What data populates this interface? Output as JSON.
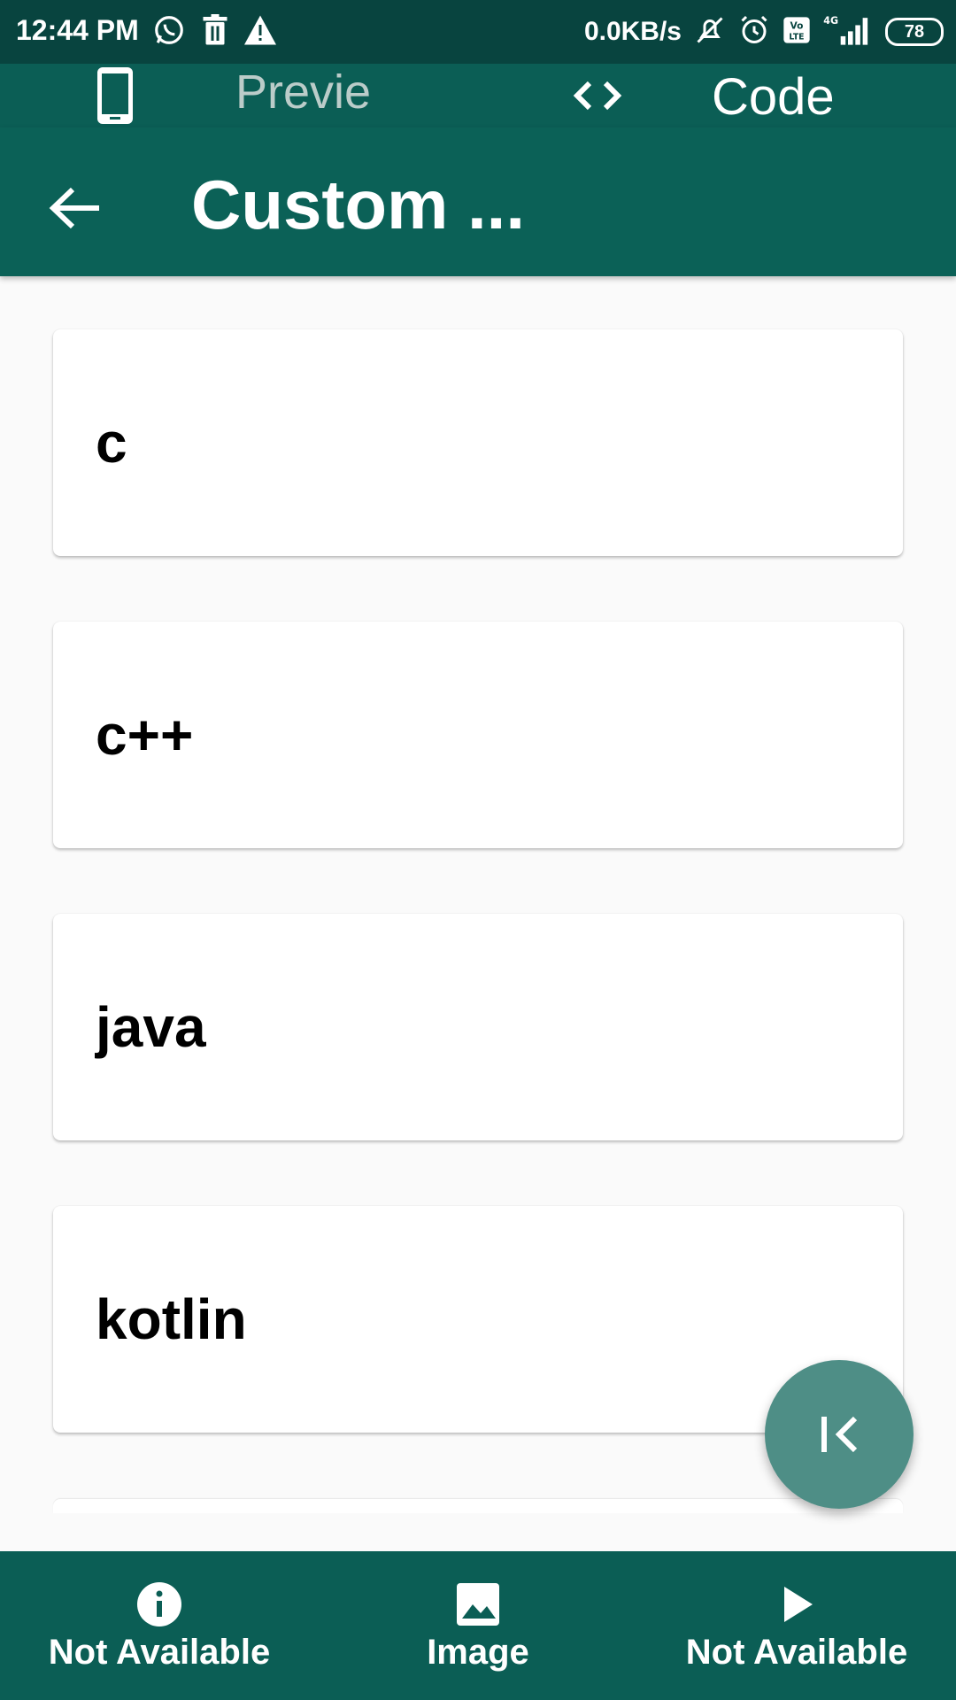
{
  "status_bar": {
    "time": "12:44 PM",
    "net_speed": "0.0KB/s",
    "battery": "78",
    "network": "4G"
  },
  "top_tabs": {
    "preview_label": "Previe w",
    "code_label": "Code"
  },
  "app_bar": {
    "title": "Custom ..."
  },
  "list": {
    "items": [
      {
        "label": "c"
      },
      {
        "label": "c++"
      },
      {
        "label": "java"
      },
      {
        "label": "kotlin"
      }
    ]
  },
  "bottom_nav": {
    "items": [
      {
        "label": "Not Available",
        "icon": "info-icon"
      },
      {
        "label": "Image",
        "icon": "image-icon"
      },
      {
        "label": "Not Available",
        "icon": "play-icon"
      }
    ]
  },
  "colors": {
    "status_bar": "#08443f",
    "primary": "#0b6157",
    "fab": "#4e8e86",
    "background": "#fafafa"
  }
}
